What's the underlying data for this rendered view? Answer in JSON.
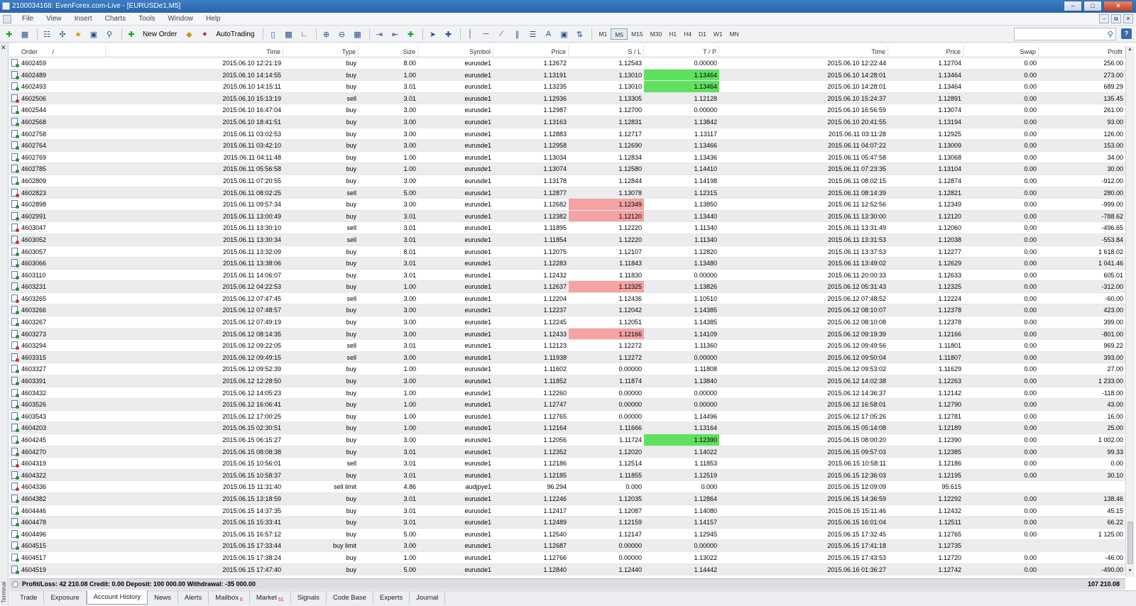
{
  "window": {
    "title": "2100034168: EvenForex.com-Live - [EURUSDe1,M5]"
  },
  "menu": [
    "File",
    "View",
    "Insert",
    "Charts",
    "Tools",
    "Window",
    "Help"
  ],
  "toolbar": {
    "new_order": "New Order",
    "autotrading": "AutoTrading",
    "timeframes": [
      "M1",
      "M5",
      "M15",
      "M30",
      "H1",
      "H4",
      "D1",
      "W1",
      "MN"
    ],
    "selected_timeframe": "M5",
    "search_value": ""
  },
  "columns": {
    "order": "Order",
    "order_sort": "/",
    "time": "Time",
    "type": "Type",
    "size": "Size",
    "symbol": "Symbol",
    "price": "Price",
    "sl": "S / L",
    "tp": "T / P",
    "close_time": "Time",
    "close_price": "Price",
    "swap": "Swap",
    "profit": "Profit"
  },
  "rows": [
    {
      "order": "4602459",
      "time": "2015.06.10 12:21:19",
      "type": "buy",
      "size": "8.00",
      "symbol": "eurusde1",
      "price": "1.12672",
      "sl": "1.12543",
      "tp": "0.00000",
      "ctime": "2015.06.10 12:22:44",
      "cprice": "1.12704",
      "swap": "0.00",
      "profit": "256.00",
      "hl_sl": "",
      "hl_tp": ""
    },
    {
      "order": "4602489",
      "time": "2015.06.10 14:14:55",
      "type": "buy",
      "size": "1.00",
      "symbol": "eurusde1",
      "price": "1.13191",
      "sl": "1.13010",
      "tp": "1.13464",
      "ctime": "2015.06.10 14:28:01",
      "cprice": "1.13464",
      "swap": "0.00",
      "profit": "273.00",
      "hl_sl": "",
      "hl_tp": "green"
    },
    {
      "order": "4602493",
      "time": "2015.06.10 14:15:11",
      "type": "buy",
      "size": "3.01",
      "symbol": "eurusde1",
      "price": "1.13235",
      "sl": "1.13010",
      "tp": "1.13464",
      "ctime": "2015.06.10 14:28:01",
      "cprice": "1.13464",
      "swap": "0.00",
      "profit": "689.29",
      "hl_sl": "",
      "hl_tp": "green"
    },
    {
      "order": "4602506",
      "time": "2015.06.10 15:13:19",
      "type": "sell",
      "size": "3.01",
      "symbol": "eurusde1",
      "price": "1.12936",
      "sl": "1.13305",
      "tp": "1.12128",
      "ctime": "2015.06.10 15:24:37",
      "cprice": "1.12891",
      "swap": "0.00",
      "profit": "135.45",
      "hl_sl": "",
      "hl_tp": ""
    },
    {
      "order": "4602544",
      "time": "2015.06.10 16:47:04",
      "type": "buy",
      "size": "3.00",
      "symbol": "eurusde1",
      "price": "1.12987",
      "sl": "1.12700",
      "tp": "0.00000",
      "ctime": "2015.06.10 16:56:59",
      "cprice": "1.13074",
      "swap": "0.00",
      "profit": "261.00",
      "hl_sl": "",
      "hl_tp": ""
    },
    {
      "order": "4602568",
      "time": "2015.06.10 18:41:51",
      "type": "buy",
      "size": "3.00",
      "symbol": "eurusde1",
      "price": "1.13163",
      "sl": "1.12831",
      "tp": "1.13842",
      "ctime": "2015.06.10 20:41:55",
      "cprice": "1.13194",
      "swap": "0.00",
      "profit": "93.00",
      "hl_sl": "",
      "hl_tp": ""
    },
    {
      "order": "4602758",
      "time": "2015.06.11 03:02:53",
      "type": "buy",
      "size": "3.00",
      "symbol": "eurusde1",
      "price": "1.12883",
      "sl": "1.12717",
      "tp": "1.13117",
      "ctime": "2015.06.11 03:11:28",
      "cprice": "1.12925",
      "swap": "0.00",
      "profit": "126.00",
      "hl_sl": "",
      "hl_tp": ""
    },
    {
      "order": "4602764",
      "time": "2015.06.11 03:42:10",
      "type": "buy",
      "size": "3.00",
      "symbol": "eurusde1",
      "price": "1.12958",
      "sl": "1.12690",
      "tp": "1.13466",
      "ctime": "2015.06.11 04:07:22",
      "cprice": "1.13009",
      "swap": "0.00",
      "profit": "153.00",
      "hl_sl": "",
      "hl_tp": ""
    },
    {
      "order": "4602769",
      "time": "2015.06.11 04:11:48",
      "type": "buy",
      "size": "1.00",
      "symbol": "eurusde1",
      "price": "1.13034",
      "sl": "1.12834",
      "tp": "1.13436",
      "ctime": "2015.06.11 05:47:58",
      "cprice": "1.13068",
      "swap": "0.00",
      "profit": "34.00",
      "hl_sl": "",
      "hl_tp": ""
    },
    {
      "order": "4602785",
      "time": "2015.06.11 05:56:58",
      "type": "buy",
      "size": "1.00",
      "symbol": "eurusde1",
      "price": "1.13074",
      "sl": "1.12580",
      "tp": "1.14410",
      "ctime": "2015.06.11 07:23:35",
      "cprice": "1.13104",
      "swap": "0.00",
      "profit": "30.00",
      "hl_sl": "",
      "hl_tp": ""
    },
    {
      "order": "4602809",
      "time": "2015.06.11 07:20:55",
      "type": "buy",
      "size": "3.00",
      "symbol": "eurusde1",
      "price": "1.13178",
      "sl": "1.12844",
      "tp": "1.14198",
      "ctime": "2015.06.11 08:02:15",
      "cprice": "1.12874",
      "swap": "0.00",
      "profit": "-912.00",
      "hl_sl": "",
      "hl_tp": ""
    },
    {
      "order": "4602823",
      "time": "2015.06.11 08:02:25",
      "type": "sell",
      "size": "5.00",
      "symbol": "eurusde1",
      "price": "1.12877",
      "sl": "1.13078",
      "tp": "1.12315",
      "ctime": "2015.06.11 08:14:39",
      "cprice": "1.12821",
      "swap": "0.00",
      "profit": "280.00",
      "hl_sl": "",
      "hl_tp": ""
    },
    {
      "order": "4602898",
      "time": "2015.06.11 09:57:34",
      "type": "buy",
      "size": "3.00",
      "symbol": "eurusde1",
      "price": "1.12682",
      "sl": "1.12349",
      "tp": "1.13850",
      "ctime": "2015.06.11 12:52:56",
      "cprice": "1.12349",
      "swap": "0.00",
      "profit": "-999.00",
      "hl_sl": "red",
      "hl_tp": ""
    },
    {
      "order": "4602991",
      "time": "2015.06.11 13:00:49",
      "type": "buy",
      "size": "3.01",
      "symbol": "eurusde1",
      "price": "1.12382",
      "sl": "1.12120",
      "tp": "1.13440",
      "ctime": "2015.06.11 13:30:00",
      "cprice": "1.12120",
      "swap": "0.00",
      "profit": "-788.62",
      "hl_sl": "red",
      "hl_tp": ""
    },
    {
      "order": "4603047",
      "time": "2015.06.11 13:30:10",
      "type": "sell",
      "size": "3.01",
      "symbol": "eurusde1",
      "price": "1.11895",
      "sl": "1.12220",
      "tp": "1.11340",
      "ctime": "2015.06.11 13:31:49",
      "cprice": "1.12060",
      "swap": "0.00",
      "profit": "-496.65",
      "hl_sl": "",
      "hl_tp": ""
    },
    {
      "order": "4603052",
      "time": "2015.06.11 13:30:34",
      "type": "sell",
      "size": "3.01",
      "symbol": "eurusde1",
      "price": "1.11854",
      "sl": "1.12220",
      "tp": "1.11340",
      "ctime": "2015.06.11 13:31:53",
      "cprice": "1.12038",
      "swap": "0.00",
      "profit": "-553.84",
      "hl_sl": "",
      "hl_tp": ""
    },
    {
      "order": "4603057",
      "time": "2015.06.11 13:32:09",
      "type": "buy",
      "size": "8.01",
      "symbol": "eurusde1",
      "price": "1.12075",
      "sl": "1.12107",
      "tp": "1.12820",
      "ctime": "2015.06.11 13:37:53",
      "cprice": "1.12277",
      "swap": "0.00",
      "profit": "1 618.02",
      "hl_sl": "",
      "hl_tp": ""
    },
    {
      "order": "4603066",
      "time": "2015.06.11 13:38:06",
      "type": "buy",
      "size": "3.01",
      "symbol": "eurusde1",
      "price": "1.12283",
      "sl": "1.11843",
      "tp": "1.13480",
      "ctime": "2015.06.11 13:49:02",
      "cprice": "1.12629",
      "swap": "0.00",
      "profit": "1 041.46",
      "hl_sl": "",
      "hl_tp": ""
    },
    {
      "order": "4603110",
      "time": "2015.06.11 14:06:07",
      "type": "buy",
      "size": "3.01",
      "symbol": "eurusde1",
      "price": "1.12432",
      "sl": "1.11830",
      "tp": "0.00000",
      "ctime": "2015.06.11 20:00:33",
      "cprice": "1.12633",
      "swap": "0.00",
      "profit": "605.01",
      "hl_sl": "",
      "hl_tp": ""
    },
    {
      "order": "4603231",
      "time": "2015.06.12 04:22:53",
      "type": "buy",
      "size": "1.00",
      "symbol": "eurusde1",
      "price": "1.12637",
      "sl": "1.12325",
      "tp": "1.13826",
      "ctime": "2015.06.12 05:31:43",
      "cprice": "1.12325",
      "swap": "0.00",
      "profit": "-312.00",
      "hl_sl": "red",
      "hl_tp": ""
    },
    {
      "order": "4603265",
      "time": "2015.06.12 07:47:45",
      "type": "sell",
      "size": "3.00",
      "symbol": "eurusde1",
      "price": "1.12204",
      "sl": "1.12436",
      "tp": "1.10510",
      "ctime": "2015.06.12 07:48:52",
      "cprice": "1.12224",
      "swap": "0.00",
      "profit": "-60.00",
      "hl_sl": "",
      "hl_tp": ""
    },
    {
      "order": "4603266",
      "time": "2015.06.12 07:48:57",
      "type": "buy",
      "size": "3.00",
      "symbol": "eurusde1",
      "price": "1.12237",
      "sl": "1.12042",
      "tp": "1.14385",
      "ctime": "2015.06.12 08:10:07",
      "cprice": "1.12378",
      "swap": "0.00",
      "profit": "423.00",
      "hl_sl": "",
      "hl_tp": ""
    },
    {
      "order": "4603267",
      "time": "2015.06.12 07:49:19",
      "type": "buy",
      "size": "3.00",
      "symbol": "eurusde1",
      "price": "1.12245",
      "sl": "1.12051",
      "tp": "1.14385",
      "ctime": "2015.06.12 08:10:08",
      "cprice": "1.12378",
      "swap": "0.00",
      "profit": "399.00",
      "hl_sl": "",
      "hl_tp": ""
    },
    {
      "order": "4603273",
      "time": "2015.06.12 08:14:35",
      "type": "buy",
      "size": "3.00",
      "symbol": "eurusde1",
      "price": "1.12433",
      "sl": "1.12166",
      "tp": "1.14109",
      "ctime": "2015.06.12 09:19:39",
      "cprice": "1.12166",
      "swap": "0.00",
      "profit": "-801.00",
      "hl_sl": "red",
      "hl_tp": ""
    },
    {
      "order": "4603294",
      "time": "2015.06.12 09:22:05",
      "type": "sell",
      "size": "3.01",
      "symbol": "eurusde1",
      "price": "1.12123",
      "sl": "1.12272",
      "tp": "1.11360",
      "ctime": "2015.06.12 09:49:56",
      "cprice": "1.11801",
      "swap": "0.00",
      "profit": "969.22",
      "hl_sl": "",
      "hl_tp": ""
    },
    {
      "order": "4603315",
      "time": "2015.06.12 09:49:15",
      "type": "sell",
      "size": "3.00",
      "symbol": "eurusde1",
      "price": "1.11938",
      "sl": "1.12272",
      "tp": "0.00000",
      "ctime": "2015.06.12 09:50:04",
      "cprice": "1.11807",
      "swap": "0.00",
      "profit": "393.00",
      "hl_sl": "",
      "hl_tp": ""
    },
    {
      "order": "4603327",
      "time": "2015.06.12 09:52:39",
      "type": "buy",
      "size": "1.00",
      "symbol": "eurusde1",
      "price": "1.11602",
      "sl": "0.00000",
      "tp": "1.11808",
      "ctime": "2015.06.12 09:53:02",
      "cprice": "1.11629",
      "swap": "0.00",
      "profit": "27.00",
      "hl_sl": "",
      "hl_tp": ""
    },
    {
      "order": "4603391",
      "time": "2015.06.12 12:28:50",
      "type": "buy",
      "size": "3.00",
      "symbol": "eurusde1",
      "price": "1.11852",
      "sl": "1.11874",
      "tp": "1.13840",
      "ctime": "2015.06.12 14:02:38",
      "cprice": "1.12263",
      "swap": "0.00",
      "profit": "1 233.00",
      "hl_sl": "",
      "hl_tp": ""
    },
    {
      "order": "4603432",
      "time": "2015.06.12 14:05:23",
      "type": "buy",
      "size": "1.00",
      "symbol": "eurusde1",
      "price": "1.12260",
      "sl": "0.00000",
      "tp": "0.00000",
      "ctime": "2015.06.12 14:36:37",
      "cprice": "1.12142",
      "swap": "0.00",
      "profit": "-118.00",
      "hl_sl": "",
      "hl_tp": ""
    },
    {
      "order": "4603526",
      "time": "2015.06.12 16:06:41",
      "type": "buy",
      "size": "1.00",
      "symbol": "eurusde1",
      "price": "1.12747",
      "sl": "0.00000",
      "tp": "0.00000",
      "ctime": "2015.06.12 16:58:01",
      "cprice": "1.12790",
      "swap": "0.00",
      "profit": "43.00",
      "hl_sl": "",
      "hl_tp": ""
    },
    {
      "order": "4603543",
      "time": "2015.06.12 17:00:25",
      "type": "buy",
      "size": "1.00",
      "symbol": "eurusde1",
      "price": "1.12765",
      "sl": "0.00000",
      "tp": "1.14496",
      "ctime": "2015.06.12 17:05:26",
      "cprice": "1.12781",
      "swap": "0.00",
      "profit": "16.00",
      "hl_sl": "",
      "hl_tp": ""
    },
    {
      "order": "4604203",
      "time": "2015.06.15 02:30:51",
      "type": "buy",
      "size": "1.00",
      "symbol": "eurusde1",
      "price": "1.12164",
      "sl": "1.11666",
      "tp": "1.13164",
      "ctime": "2015.06.15 05:14:08",
      "cprice": "1.12189",
      "swap": "0.00",
      "profit": "25.00",
      "hl_sl": "",
      "hl_tp": ""
    },
    {
      "order": "4604245",
      "time": "2015.06.15 06:15:27",
      "type": "buy",
      "size": "3.00",
      "symbol": "eurusde1",
      "price": "1.12056",
      "sl": "1.11724",
      "tp": "1.12390",
      "ctime": "2015.06.15 08:00:20",
      "cprice": "1.12390",
      "swap": "0.00",
      "profit": "1 002.00",
      "hl_sl": "",
      "hl_tp": "green"
    },
    {
      "order": "4604270",
      "time": "2015.06.15 08:08:38",
      "type": "buy",
      "size": "3.01",
      "symbol": "eurusde1",
      "price": "1.12352",
      "sl": "1.12020",
      "tp": "1.14022",
      "ctime": "2015.06.15 09:57:03",
      "cprice": "1.12385",
      "swap": "0.00",
      "profit": "99.33",
      "hl_sl": "",
      "hl_tp": ""
    },
    {
      "order": "4604319",
      "time": "2015.06.15 10:56:01",
      "type": "sell",
      "size": "3.01",
      "symbol": "eurusde1",
      "price": "1.12186",
      "sl": "1.12514",
      "tp": "1.11853",
      "ctime": "2015.06.15 10:58:11",
      "cprice": "1.12186",
      "swap": "0.00",
      "profit": "0.00",
      "hl_sl": "",
      "hl_tp": ""
    },
    {
      "order": "4604322",
      "time": "2015.06.15 10:58:37",
      "type": "buy",
      "size": "3.01",
      "symbol": "eurusde1",
      "price": "1.12185",
      "sl": "1.11855",
      "tp": "1.12519",
      "ctime": "2015.06.15 12:36:03",
      "cprice": "1.12195",
      "swap": "0.00",
      "profit": "30.10",
      "hl_sl": "",
      "hl_tp": ""
    },
    {
      "order": "4604336",
      "time": "2015.06.15 11:31:40",
      "type": "sell limit",
      "size": "4.86",
      "symbol": "audjpye1",
      "price": "96.294",
      "sl": "0.000",
      "tp": "0.000",
      "ctime": "2015.06.15 12:09:09",
      "cprice": "95.615",
      "swap": "",
      "profit": "",
      "hl_sl": "",
      "hl_tp": ""
    },
    {
      "order": "4604382",
      "time": "2015.06.15 13:18:59",
      "type": "buy",
      "size": "3.01",
      "symbol": "eurusde1",
      "price": "1.12246",
      "sl": "1.12035",
      "tp": "1.12864",
      "ctime": "2015.06.15 14:36:59",
      "cprice": "1.12292",
      "swap": "0.00",
      "profit": "138.46",
      "hl_sl": "",
      "hl_tp": ""
    },
    {
      "order": "4604446",
      "time": "2015.06.15 14:37:35",
      "type": "buy",
      "size": "3.01",
      "symbol": "eurusde1",
      "price": "1.12417",
      "sl": "1.12087",
      "tp": "1.14080",
      "ctime": "2015.06.15 15:11:46",
      "cprice": "1.12432",
      "swap": "0.00",
      "profit": "45.15",
      "hl_sl": "",
      "hl_tp": ""
    },
    {
      "order": "4604478",
      "time": "2015.06.15 15:33:41",
      "type": "buy",
      "size": "3.01",
      "symbol": "eurusde1",
      "price": "1.12489",
      "sl": "1.12159",
      "tp": "1.14157",
      "ctime": "2015.06.15 16:01:04",
      "cprice": "1.12511",
      "swap": "0.00",
      "profit": "66.22",
      "hl_sl": "",
      "hl_tp": ""
    },
    {
      "order": "4604496",
      "time": "2015.06.15 16:57:12",
      "type": "buy",
      "size": "5.00",
      "symbol": "eurusde1",
      "price": "1.12540",
      "sl": "1.12147",
      "tp": "1.12945",
      "ctime": "2015.06.15 17:32:45",
      "cprice": "1.12765",
      "swap": "0.00",
      "profit": "1 125.00",
      "hl_sl": "",
      "hl_tp": ""
    },
    {
      "order": "4604515",
      "time": "2015.06.15 17:33:44",
      "type": "buy limit",
      "size": "3.00",
      "symbol": "eurusde1",
      "price": "1.12687",
      "sl": "0.00000",
      "tp": "0.00000",
      "ctime": "2015.06.15 17:41:18",
      "cprice": "1.12735",
      "swap": "",
      "profit": "",
      "hl_sl": "",
      "hl_tp": ""
    },
    {
      "order": "4604517",
      "time": "2015.06.15 17:38:24",
      "type": "buy",
      "size": "1.00",
      "symbol": "eurusde1",
      "price": "1.12766",
      "sl": "0.00000",
      "tp": "1.13022",
      "ctime": "2015.06.15 17:43:53",
      "cprice": "1.12720",
      "swap": "0.00",
      "profit": "-46.00",
      "hl_sl": "",
      "hl_tp": ""
    },
    {
      "order": "4604519",
      "time": "2015.06.15 17:47:40",
      "type": "buy",
      "size": "5.00",
      "symbol": "eurusde1",
      "price": "1.12840",
      "sl": "1.12440",
      "tp": "1.14442",
      "ctime": "2015.06.16 01:36:27",
      "cprice": "1.12742",
      "swap": "0.00",
      "profit": "-490.00",
      "hl_sl": "",
      "hl_tp": ""
    }
  ],
  "summary": {
    "text": "Profit/Loss: 42 210.08  Credit: 0.00  Deposit: 100 000.00  Withdrawal: -35 000.00",
    "total": "107 210.08"
  },
  "tabs": [
    {
      "label": "Trade",
      "badge": ""
    },
    {
      "label": "Exposure",
      "badge": ""
    },
    {
      "label": "Account History",
      "badge": "",
      "active": true
    },
    {
      "label": "News",
      "badge": ""
    },
    {
      "label": "Alerts",
      "badge": ""
    },
    {
      "label": "Mailbox",
      "badge": "6"
    },
    {
      "label": "Market",
      "badge": "51"
    },
    {
      "label": "Signals",
      "badge": ""
    },
    {
      "label": "Code Base",
      "badge": ""
    },
    {
      "label": "Experts",
      "badge": ""
    },
    {
      "label": "Journal",
      "badge": ""
    }
  ],
  "side_label": "Terminal"
}
